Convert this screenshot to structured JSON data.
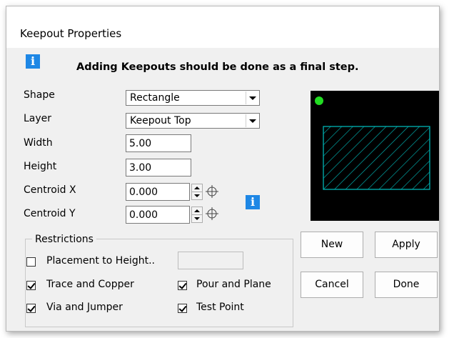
{
  "dialog": {
    "title": "Keepout Properties",
    "warning": "Adding Keepouts should be done as a final step."
  },
  "fields": {
    "shape_label": "Shape",
    "shape_value": "Rectangle",
    "layer_label": "Layer",
    "layer_value": "Keepout Top",
    "width_label": "Width",
    "width_value": "5.00",
    "height_label": "Height",
    "height_value": "3.00",
    "centroid_x_label": "Centroid X",
    "centroid_x_value": "0.000",
    "centroid_y_label": "Centroid Y",
    "centroid_y_value": "0.000"
  },
  "restrictions": {
    "title": "Restrictions",
    "placement_label": "Placement to Height..",
    "placement_checked": false,
    "placement_value": "",
    "trace_label": "Trace and Copper",
    "trace_checked": true,
    "pour_label": "Pour and Plane",
    "pour_checked": true,
    "via_label": "Via and Jumper",
    "via_checked": true,
    "test_label": "Test Point",
    "test_checked": true
  },
  "buttons": {
    "new": "New",
    "apply": "Apply",
    "cancel": "Cancel",
    "done": "Done"
  },
  "colors": {
    "info_icon": "#1e87e5",
    "preview_bg": "#000000",
    "preview_hatch": "#00b4b4",
    "preview_dot": "#22dd22"
  }
}
